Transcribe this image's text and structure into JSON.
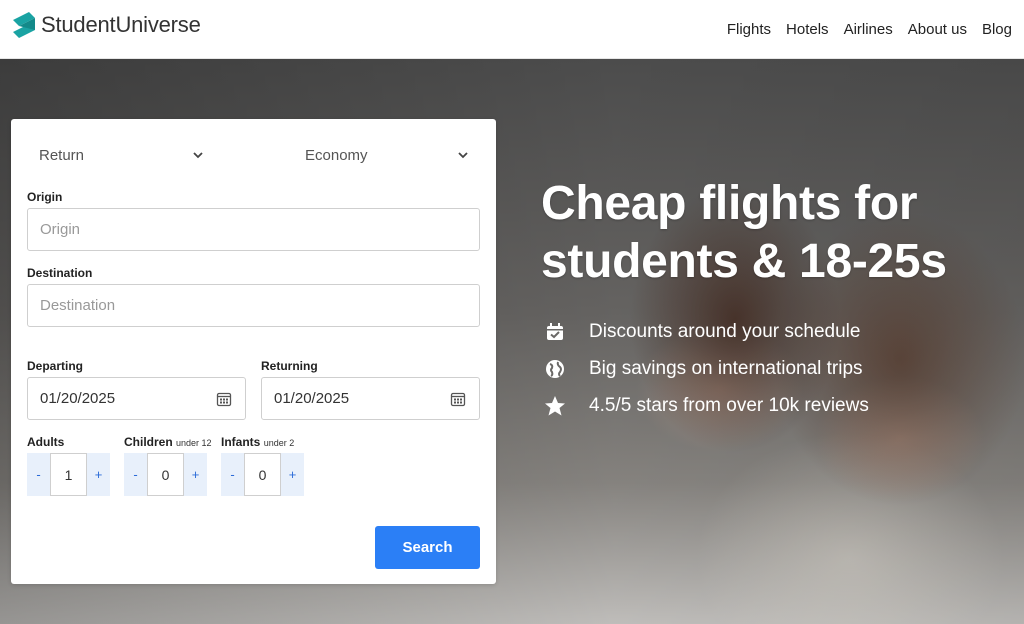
{
  "brand": {
    "name": "StudentUniverse",
    "color": "#1aa3a3"
  },
  "nav": {
    "items": [
      "Flights",
      "Hotels",
      "Airlines",
      "About us",
      "Blog"
    ]
  },
  "hero": {
    "headline_line1": "Cheap flights for",
    "headline_line2": "students & 18-25s",
    "features": [
      {
        "icon": "calendar-check-icon",
        "text": "Discounts around your schedule"
      },
      {
        "icon": "globe-icon",
        "text": "Big savings on international trips"
      },
      {
        "icon": "star-icon",
        "text": "4.5/5 stars from over 10k reviews"
      }
    ]
  },
  "search": {
    "trip_type": "Return",
    "cabin_class": "Economy",
    "origin_label": "Origin",
    "origin_placeholder": "Origin",
    "destination_label": "Destination",
    "destination_placeholder": "Destination",
    "departing_label": "Departing",
    "departing_value": "01/20/2025",
    "returning_label": "Returning",
    "returning_value": "01/20/2025",
    "adults_label": "Adults",
    "adults_value": "1",
    "children_label": "Children",
    "children_note": "under 12",
    "children_value": "0",
    "infants_label": "Infants",
    "infants_note": "under 2",
    "infants_value": "0",
    "minus": "-",
    "plus": "+",
    "button_label": "Search",
    "accent_color": "#2b7ff6"
  }
}
